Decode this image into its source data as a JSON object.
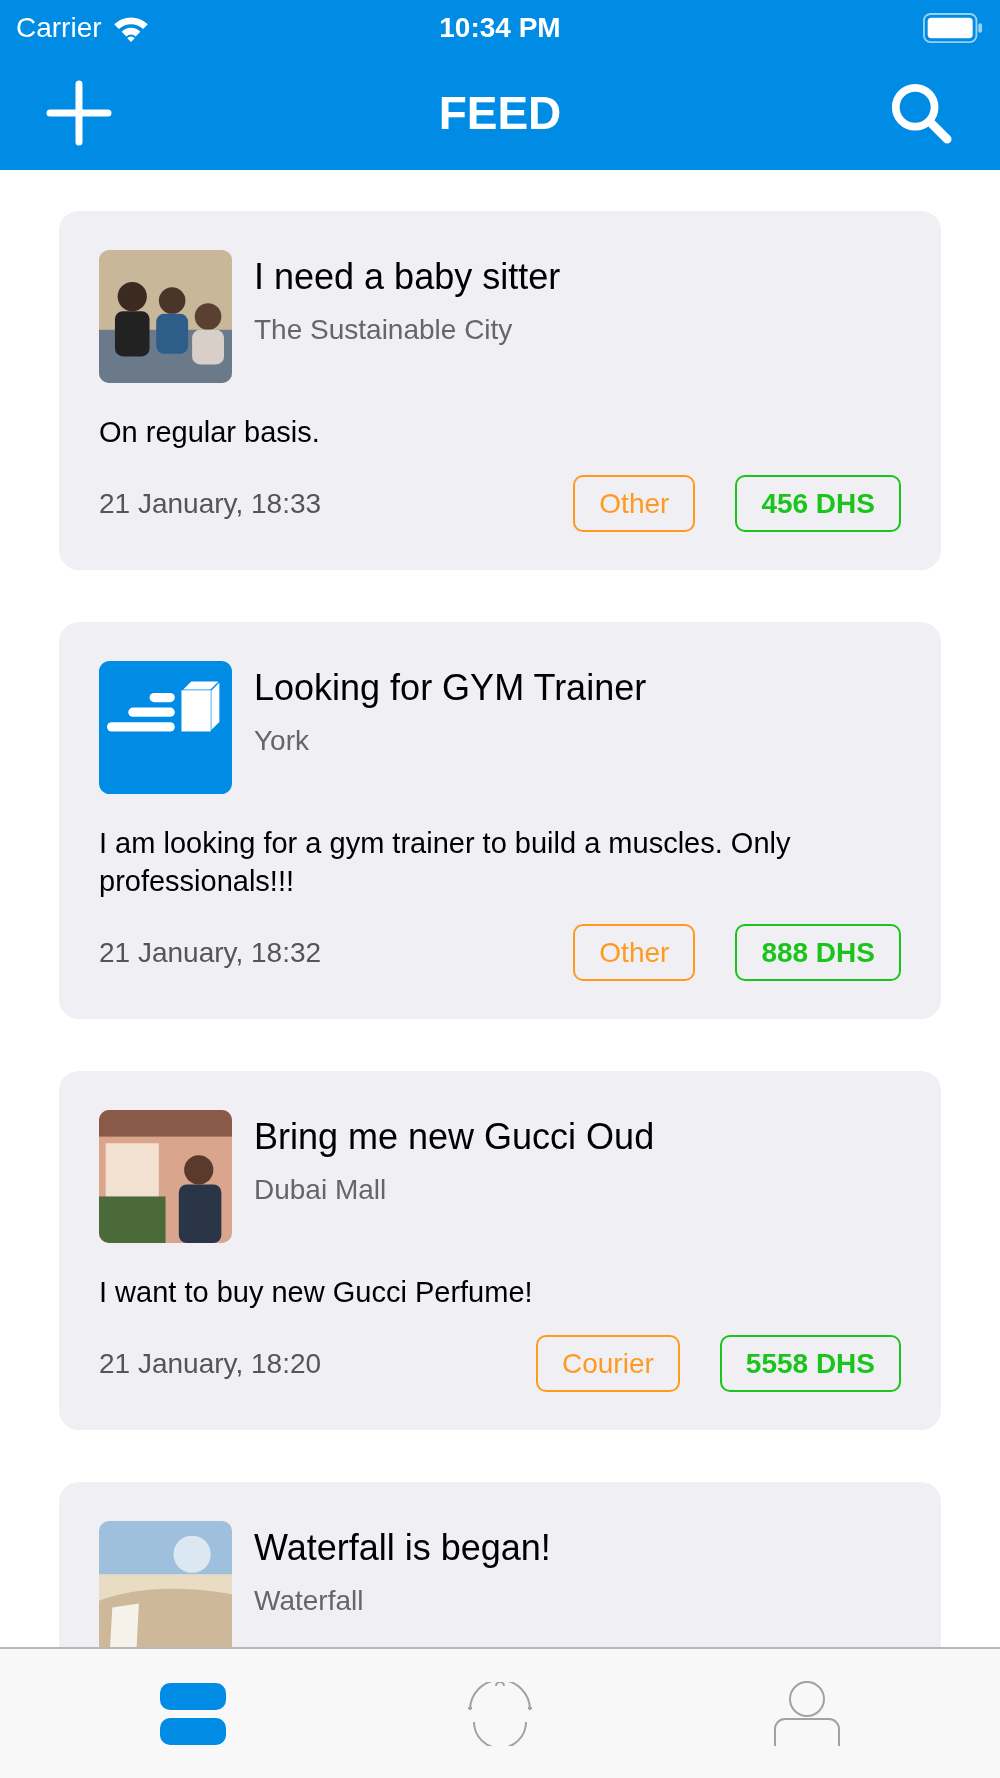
{
  "status_bar": {
    "carrier": "Carrier",
    "time": "10:34 PM"
  },
  "nav_bar": {
    "title": "FEED"
  },
  "posts": [
    {
      "title": "I need a baby sitter",
      "location": "The Sustainable City",
      "description": "On regular basis.",
      "date": "21 January, 18:33",
      "category": "Other",
      "price": "456 DHS"
    },
    {
      "thumbnail": {
        "kind": "icon"
      },
      "title": "Looking for GYM Trainer",
      "location": "York",
      "description": "I am looking for a gym trainer to build a muscles. Only professionals!!!",
      "date": "21 January, 18:32",
      "category": "Other",
      "price": "888 DHS"
    },
    {
      "title": "Bring me new Gucci Oud",
      "location": "Dubai Mall",
      "description": "I want to buy new Gucci Perfume!",
      "date": "21 January, 18:20",
      "category": "Courier",
      "price": "5558 DHS"
    },
    {
      "title": "Waterfall is began!",
      "location": "Waterfall"
    }
  ],
  "tab_bar": [
    {
      "kind": "feed",
      "selected": true
    },
    {
      "kind": "baby",
      "selected": false
    },
    {
      "kind": "profile",
      "selected": false
    }
  ]
}
